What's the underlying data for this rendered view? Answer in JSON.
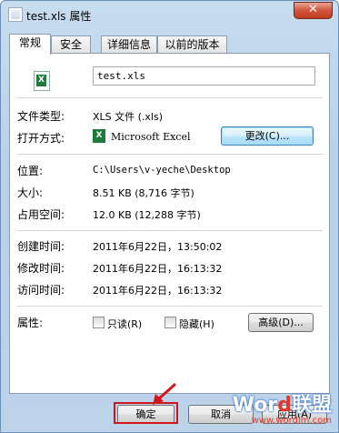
{
  "window": {
    "title": "test.xls 属性",
    "close_glyph": "✕"
  },
  "tabs": [
    {
      "label": "常规"
    },
    {
      "label": "安全"
    },
    {
      "label": "详细信息"
    },
    {
      "label": "以前的版本"
    }
  ],
  "general": {
    "file_name": "test.xls",
    "file_type_label": "文件类型:",
    "file_type_value": "XLS 文件 (.xls)",
    "opens_with_label": "打开方式:",
    "opens_with_value": "Microsoft Excel",
    "change_button": "更改(C)...",
    "location_label": "位置:",
    "location_value": "C:\\Users\\v-yeche\\Desktop",
    "size_label": "大小:",
    "size_value": "8.51 KB (8,716 字节)",
    "size_on_disk_label": "占用空间:",
    "size_on_disk_value": "12.0 KB (12,288 字节)",
    "created_label": "创建时间:",
    "created_value": "2011年6月22日，13:50:02",
    "modified_label": "修改时间:",
    "modified_value": "2011年6月22日，16:13:32",
    "accessed_label": "访问时间:",
    "accessed_value": "2011年6月22日，16:13:32",
    "attributes_label": "属性:",
    "readonly_label": "只读(R)",
    "hidden_label": "隐藏(H)",
    "advanced_button": "高级(D)..."
  },
  "footer": {
    "ok_button": "确定",
    "cancel_button": "取消",
    "apply_button": "应用(A)"
  },
  "watermark": {
    "part1": "Wor",
    "part2": "d",
    "part3": "联盟",
    "url": "www.wordlm.com"
  },
  "colors": {
    "highlight_frame": "#d2141b",
    "excel_green": "#1d7a3a",
    "title_bar": "#b8d0e8"
  }
}
